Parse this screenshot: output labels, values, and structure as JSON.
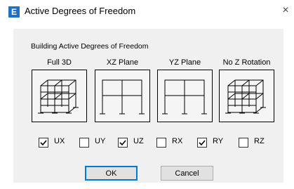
{
  "window": {
    "title": "Active Degrees of Freedom",
    "app_icon_letter": "E",
    "close_glyph": "×"
  },
  "group": {
    "title": "Building Active Degrees of Freedom"
  },
  "presets": [
    {
      "label": "Full 3D",
      "icon": "3d-frame-icon"
    },
    {
      "label": "XZ Plane",
      "icon": "xz-plane-frame-icon"
    },
    {
      "label": "YZ Plane",
      "icon": "yz-plane-frame-icon"
    },
    {
      "label": "No Z Rotation",
      "icon": "no-z-rotation-frame-icon"
    }
  ],
  "dofs": [
    {
      "label": "UX",
      "checked": true
    },
    {
      "label": "UY",
      "checked": false
    },
    {
      "label": "UZ",
      "checked": true
    },
    {
      "label": "RX",
      "checked": false
    },
    {
      "label": "RY",
      "checked": true
    },
    {
      "label": "RZ",
      "checked": false
    }
  ],
  "buttons": {
    "ok": "OK",
    "cancel": "Cancel"
  }
}
